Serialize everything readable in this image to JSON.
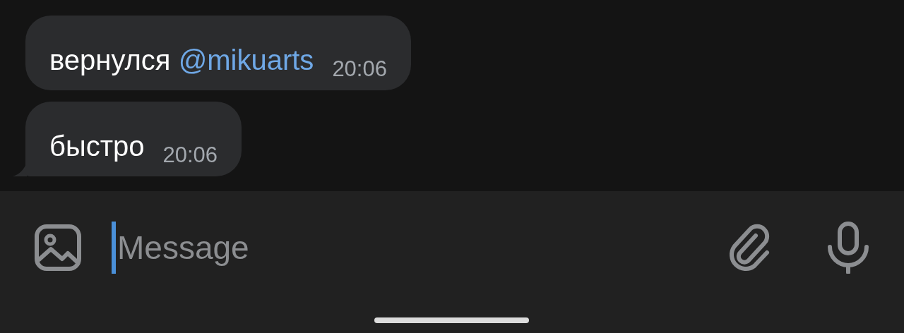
{
  "messages": [
    {
      "parts": [
        {
          "kind": "text",
          "text": "вернулся "
        },
        {
          "kind": "mention",
          "text": "@mikuarts"
        }
      ],
      "time": "20:06",
      "tail": false
    },
    {
      "parts": [
        {
          "kind": "text",
          "text": "быстро"
        }
      ],
      "time": "20:06",
      "tail": true
    }
  ],
  "composer": {
    "placeholder": "Message"
  }
}
